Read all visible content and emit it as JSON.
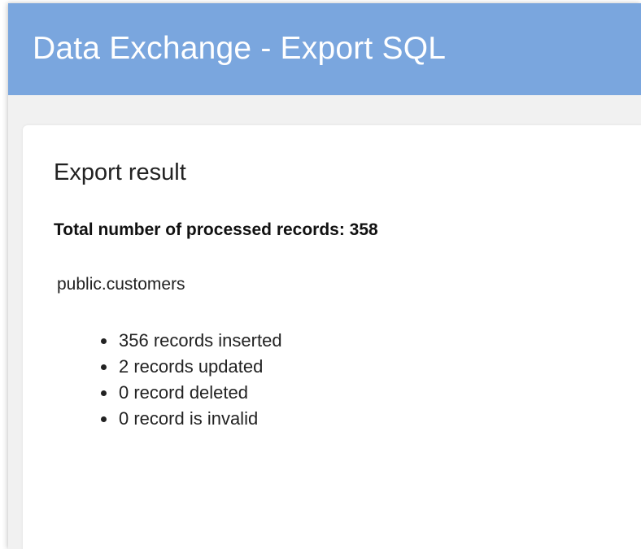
{
  "header": {
    "title": "Data Exchange - Export SQL"
  },
  "result": {
    "title": "Export result",
    "total_label": "Total number of processed records: 358",
    "table_name": "public.customers",
    "items": [
      {
        "label": "356 records inserted"
      },
      {
        "label": "2 records updated"
      },
      {
        "label": "0 record deleted"
      },
      {
        "label": "0 record is invalid"
      }
    ]
  },
  "colors": {
    "header_background": "#7aa6de",
    "page_background": "#f1f1f1",
    "card_background": "#ffffff"
  }
}
